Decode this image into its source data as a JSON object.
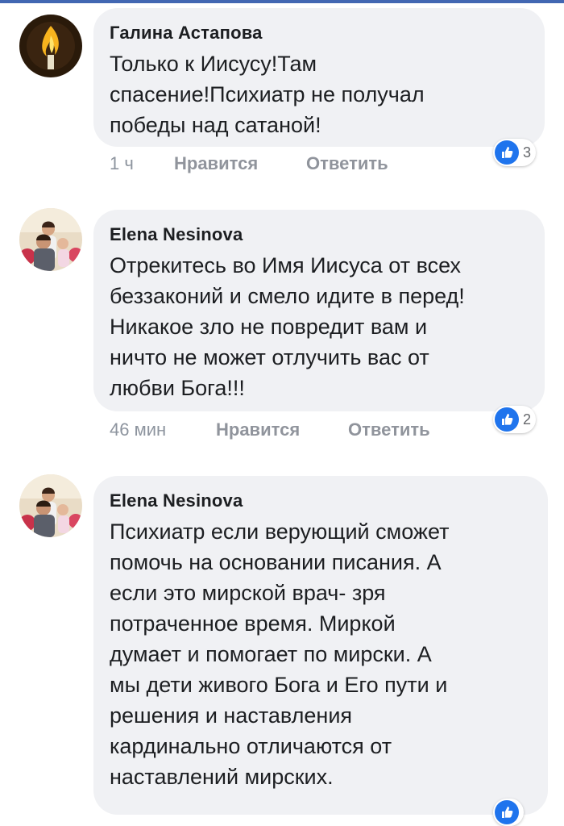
{
  "comments": [
    {
      "author": "Галина Астапова",
      "avatar_icon": "candle-flame-avatar",
      "text": "Только к Иисусу!Там\nспасение!Психиатр не получал\nпобеды над сатаной!",
      "time": "1 ч",
      "like_label": "Нравится",
      "reply_label": "Ответить",
      "reaction_icon": "thumbs-up-icon",
      "reaction_count": "3"
    },
    {
      "author": "Elena Nesinova",
      "avatar_icon": "family-photo-avatar",
      "text": "Отрекитесь во Имя Иисуса от всех\nбеззаконий и смело идите в перед!\nНикакое зло не повредит вам и\nничто не может отлучить вас от\nлюбви Бога!!!",
      "time": "46 мин",
      "like_label": "Нравится",
      "reply_label": "Ответить",
      "reaction_icon": "thumbs-up-icon",
      "reaction_count": "2"
    },
    {
      "author": "Elena Nesinova",
      "avatar_icon": "family-photo-avatar",
      "text": "Психиатр если верующий сможет\nпомочь на основании писания. А\nесли это мирской врач- зря\nпотраченное время. Миркой\nдумает и помогает по мирски. А\nмы дети живого Бога и Его пути и\nрешения и наставления\nкардинально отличаются от\nнаставлений мирских.",
      "reaction_icon": "thumbs-up-icon"
    }
  ],
  "colors": {
    "bubble": "#f0f1f4",
    "like_blue": "#1f74ed",
    "meta_gray": "#8d949e"
  }
}
